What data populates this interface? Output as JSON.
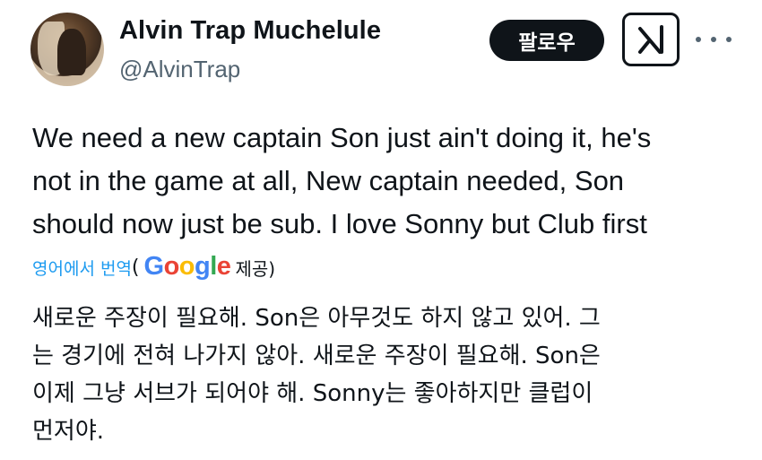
{
  "author": {
    "display_name": "Alvin Trap Muchelule",
    "handle": "@AlvinTrap"
  },
  "actions": {
    "follow_label": "팔로우",
    "grok_icon": "grok-icon",
    "more_icon": "more-icon"
  },
  "tweet": {
    "lines": [
      "We need a new captain Son just ain't  doing it, he's",
      "not in the game at all, New captain needed, Son",
      "should now just be sub. I love Sonny but Club first"
    ]
  },
  "translation": {
    "from_label": "영어에서 번역",
    "open_paren": "(",
    "provider": "Google",
    "provided_label": "제공)",
    "lines": [
      "새로운 주장이 필요해. Son은 아무것도 하지 않고 있어. 그",
      "는 경기에 전혀 나가지 않아. 새로운 주장이 필요해. Son은",
      "이제 그냥 서브가 되어야 해. Sonny는 좋아하지만 클럽이",
      "먼저야."
    ]
  },
  "colors": {
    "text": "#0f1419",
    "secondary": "#536471",
    "link": "#1d9bf0",
    "button_bg": "#0f1419"
  }
}
